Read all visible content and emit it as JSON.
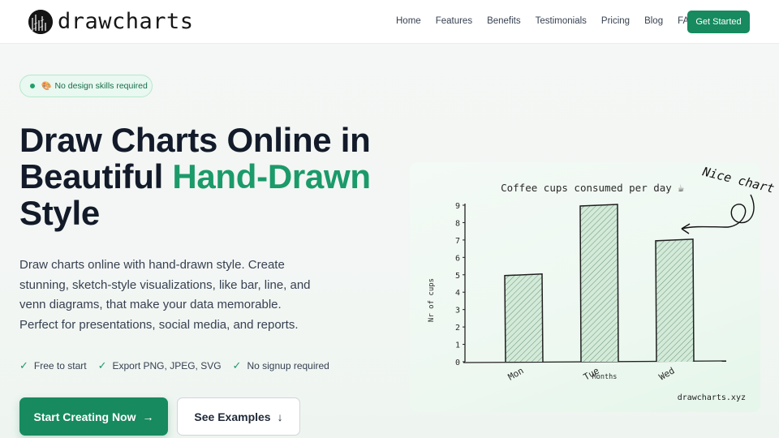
{
  "brand": {
    "name": "drawcharts"
  },
  "nav": {
    "items": [
      "Home",
      "Features",
      "Benefits",
      "Testimonials",
      "Pricing",
      "Blog",
      "FAQ"
    ],
    "cta": "Get Started"
  },
  "hero": {
    "badge": {
      "emoji": "🎨",
      "text": "No design skills required"
    },
    "title_line1": "Draw Charts Online in",
    "title_line2_plain": "Beautiful ",
    "title_line2_accent": "Hand-Drawn",
    "title_line3": "Style",
    "description": "Draw charts online with hand-drawn style. Create stunning, sketch-style visualizations, like bar, line, and venn diagrams, that make your data memorable. Perfect for presentations, social media, and reports.",
    "features": [
      "Free to start",
      "Export PNG, JPEG, SVG",
      "No signup required"
    ],
    "primary_button": "Start Creating Now",
    "secondary_button": "See Examples"
  },
  "colors": {
    "accent": "#178a5f",
    "accent_text": "#1b9a6a",
    "bar_fill": "#cfe8d6",
    "ink": "#222222"
  },
  "icons": {
    "check": "check-icon",
    "arrow_right": "arrow-right-icon",
    "arrow_down": "arrow-down-icon"
  },
  "chart_data": {
    "type": "bar",
    "title": "Coffee cups consumed per day ☕",
    "categories": [
      "Mon",
      "Tue",
      "Wed"
    ],
    "values": [
      5,
      9,
      7
    ],
    "xlabel": "Months",
    "ylabel": "Nr of cups",
    "ylim": [
      0,
      9
    ],
    "yticks": [
      0,
      1,
      2,
      3,
      4,
      5,
      6,
      7,
      8,
      9
    ],
    "annotation": "Nice chart!",
    "watermark": "drawcharts.xyz",
    "grid": false
  }
}
